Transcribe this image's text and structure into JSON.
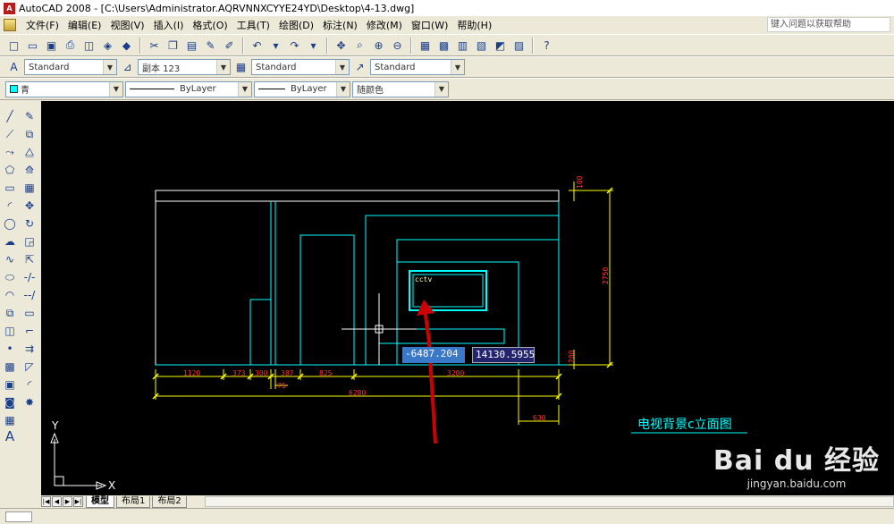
{
  "window": {
    "title": "AutoCAD 2008 - [C:\\Users\\Administrator.AQRVNNXCYYE24YD\\Desktop\\4-13.dwg]"
  },
  "menu": {
    "items": [
      "文件(F)",
      "编辑(E)",
      "视图(V)",
      "插入(I)",
      "格式(O)",
      "工具(T)",
      "绘图(D)",
      "标注(N)",
      "修改(M)",
      "窗口(W)",
      "帮助(H)"
    ],
    "help_placeholder": "键入问题以获取帮助"
  },
  "styles": {
    "text_style": "Standard",
    "dim_style": "副本 123",
    "table_style": "Standard",
    "mleader_style": "Standard"
  },
  "properties": {
    "layer": "青",
    "linetype": "ByLayer",
    "lineweight": "ByLayer",
    "plotstyle": "随颜色"
  },
  "canvas": {
    "screen_label": "cctv",
    "title": "电视背景c立面图",
    "coord_x": "-6487",
    "coord_x_tail": ".204",
    "coord_y": "14130.5955",
    "ucs_x": "X",
    "ucs_y": "Y",
    "dims": {
      "d1120": "1120",
      "d373": "373",
      "d300": "300",
      "d387": "387",
      "d825": "825",
      "d3200": "3200",
      "d75": "75",
      "d6280": "6280",
      "d630": "630",
      "d2750": "2750",
      "d100": "100",
      "d200": "200"
    }
  },
  "layout_tabs": [
    "模型",
    "布局1",
    "布局2"
  ],
  "watermark": {
    "brand": "Bai du 经验",
    "url": "jingyan.baidu.com"
  },
  "colors": {
    "canvas_bg": "#000000",
    "geometry": "#00ffff",
    "dims": "#ffff00",
    "dim_text": "#ff3333",
    "annot": "#cc0000"
  }
}
